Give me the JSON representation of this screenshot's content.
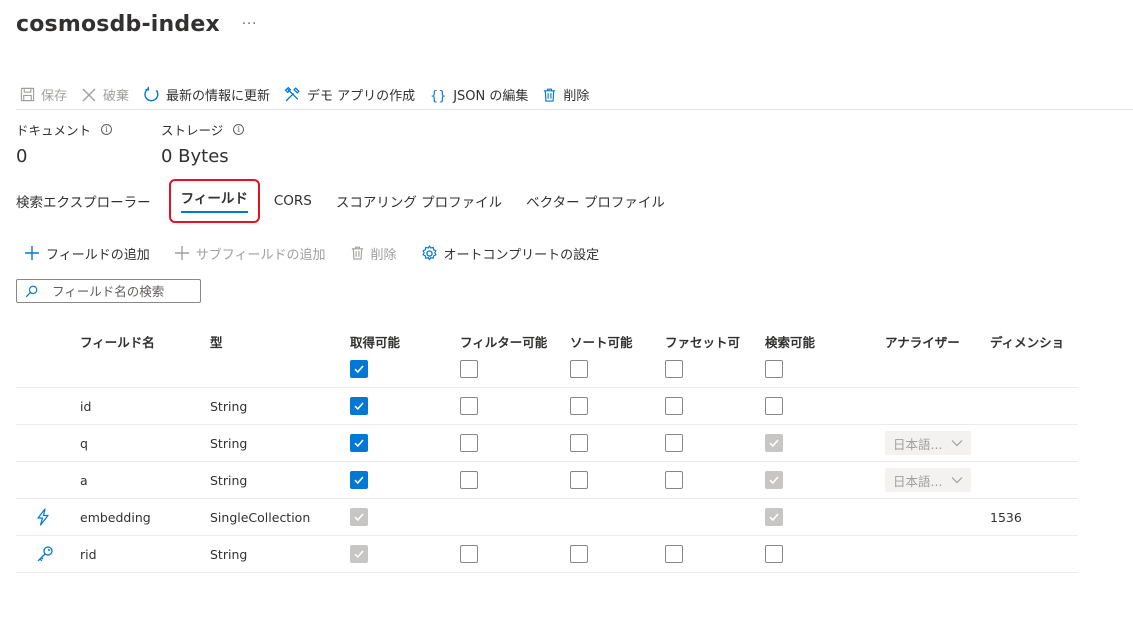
{
  "header": {
    "title": "cosmosdb-index",
    "more": "···"
  },
  "toolbar": {
    "save": "保存",
    "discard": "破棄",
    "refresh": "最新の情報に更新",
    "demo_app": "デモ アプリの作成",
    "edit_json": "JSON の編集",
    "delete": "削除"
  },
  "metrics": {
    "documents_label": "ドキュメント",
    "documents_value": "0",
    "storage_label": "ストレージ",
    "storage_value": "0 Bytes"
  },
  "tabs": {
    "explorer": "検索エクスプローラー",
    "fields": "フィールド",
    "cors": "CORS",
    "scoring": "スコアリング プロファイル",
    "vector": "ベクター プロファイル"
  },
  "commands": {
    "add_field": "フィールドの追加",
    "add_subfield": "サブフィールドの追加",
    "delete": "削除",
    "autocomplete": "オートコンプリートの設定"
  },
  "search": {
    "placeholder": "フィールド名の検索"
  },
  "colors": {
    "accent": "#0078d4",
    "highlight_border": "#e81123",
    "disabled": "#c8c6c4"
  },
  "table": {
    "columns": {
      "name": "フィールド名",
      "type": "型",
      "retrievable": "取得可能",
      "filterable": "フィルター可能",
      "sortable": "ソート可能",
      "facetable": "ファセット可",
      "searchable": "検索可能",
      "analyzer": "アナライザー",
      "dimensions": "ディメンショ"
    },
    "rows": [
      {
        "name": "id",
        "type": "String",
        "analyzer": "",
        "dimensions": ""
      },
      {
        "name": "q",
        "type": "String",
        "analyzer": "日本語...",
        "dimensions": ""
      },
      {
        "name": "a",
        "type": "String",
        "analyzer": "日本語...",
        "dimensions": ""
      },
      {
        "name": "embedding",
        "type": "SingleCollection",
        "analyzer": "",
        "dimensions": "1536",
        "icon": "lightning-icon"
      },
      {
        "name": "rid",
        "type": "String",
        "analyzer": "",
        "dimensions": "",
        "icon": "key-icon"
      }
    ]
  }
}
